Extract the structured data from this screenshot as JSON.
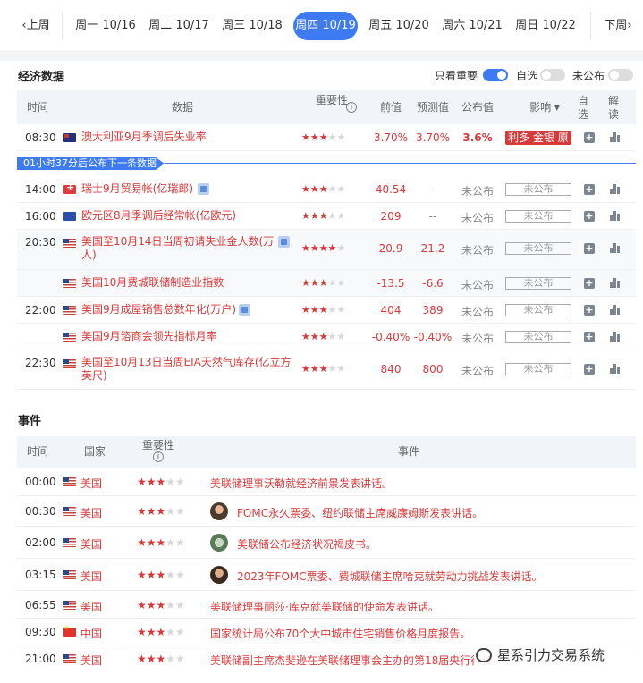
{
  "week_nav": {
    "prev": "上周",
    "next": "下周",
    "days": [
      "周一 10/16",
      "周二 10/17",
      "周三 10/18",
      "周四 10/19",
      "周五 10/20",
      "周六 10/21",
      "周日 10/22"
    ],
    "active_index": 3
  },
  "econ": {
    "title": "经济数据",
    "toggles": [
      {
        "label": "只看重要",
        "on": true
      },
      {
        "label": "自选",
        "on": false
      },
      {
        "label": "未公布",
        "on": false
      }
    ],
    "headers": {
      "time": "时间",
      "data": "数据",
      "importance": "重要性",
      "prev": "前值",
      "forecast": "预测值",
      "actual": "公布值",
      "impact": "影响",
      "watch": "自选",
      "interp": "解读"
    },
    "banner": "01小时37分后公布下一条数据",
    "rows": [
      {
        "time": "08:30",
        "flag": "au",
        "name": "澳大利亚9月季调后失业率",
        "stars": 3,
        "prev": "3.70%",
        "forecast": "3.70%",
        "actual": "3.6%",
        "impact": "利多 金银 原",
        "badge": false
      },
      {
        "time": "14:00",
        "flag": "ch",
        "name": "瑞士9月贸易帐(亿瑞郎)",
        "stars": 3,
        "prev": "40.54",
        "forecast": "--",
        "actual": "未公布",
        "pending": "未公布",
        "badge": true
      },
      {
        "time": "16:00",
        "flag": "eu",
        "name": "欧元区8月季调后经常帐(亿欧元)",
        "stars": 3,
        "prev": "209",
        "forecast": "--",
        "actual": "未公布",
        "pending": "未公布",
        "badge": false
      },
      {
        "time": "20:30",
        "flag": "us",
        "name": "美国至10月14日当周初请失业金人数(万",
        "name2": "人)",
        "stars": 4,
        "prev": "20.9",
        "forecast": "21.2",
        "actual": "未公布",
        "pending": "未公布",
        "badge": true
      },
      {
        "time": "",
        "flag": "us",
        "name": "美国10月费城联储制造业指数",
        "stars": 3,
        "prev": "-13.5",
        "forecast": "-6.6",
        "actual": "未公布",
        "pending": "未公布",
        "badge": false
      },
      {
        "time": "22:00",
        "flag": "us",
        "name": "美国9月成屋销售总数年化(万户)",
        "stars": 3,
        "prev": "404",
        "forecast": "389",
        "actual": "未公布",
        "pending": "未公布",
        "badge": true
      },
      {
        "time": "",
        "flag": "us",
        "name": "美国9月谘商会领先指标月率",
        "stars": 3,
        "prev": "-0.40%",
        "forecast": "-0.40%",
        "actual": "未公布",
        "pending": "未公布",
        "badge": false
      },
      {
        "time": "22:30",
        "flag": "us",
        "name": "美国至10月13日当周EIA天然气库存(亿立方",
        "name2": "英尺)",
        "stars": 3,
        "prev": "840",
        "forecast": "800",
        "actual": "未公布",
        "pending": "未公布",
        "badge": false
      }
    ]
  },
  "events": {
    "title": "事件",
    "headers": {
      "time": "时间",
      "country": "国家",
      "importance": "重要性",
      "event": "事件"
    },
    "rows": [
      {
        "time": "00:00",
        "flag": "us",
        "country": "美国",
        "stars": 3,
        "avatar": "",
        "text": "美联储理事沃勒就经济前景发表讲话。"
      },
      {
        "time": "00:30",
        "flag": "us",
        "country": "美国",
        "stars": 3,
        "avatar": "person-avatar",
        "text": "FOMC永久票委、纽约联储主席威廉姆斯发表讲话。"
      },
      {
        "time": "02:00",
        "flag": "us",
        "country": "美国",
        "stars": 3,
        "avatar": "fed-seal-avatar",
        "text": "美联储公布经济状况褐皮书。"
      },
      {
        "time": "03:15",
        "flag": "us",
        "country": "美国",
        "stars": 3,
        "avatar": "person-avatar",
        "text": "2023年FOMC票委、费城联储主席哈克就劳动力挑战发表讲话。"
      },
      {
        "time": "06:55",
        "flag": "us",
        "country": "美国",
        "stars": 3,
        "avatar": "",
        "text": "美联储理事丽莎·库克就美联储的使命发表讲话。"
      },
      {
        "time": "09:30",
        "flag": "cn",
        "country": "中国",
        "stars": 3,
        "avatar": "",
        "text": "国家统计局公布70个大中城市住宅销售价格月度报告。"
      },
      {
        "time": "21:00",
        "flag": "us",
        "country": "美国",
        "stars": 3,
        "avatar": "",
        "text": "美联储副主席杰斐逊在美联储理事会主办的第18届央行行长"
      }
    ]
  },
  "watermark": "星系引力交易系统",
  "colors": {
    "accent": "#3e7bf2",
    "red": "#d83a3a"
  }
}
